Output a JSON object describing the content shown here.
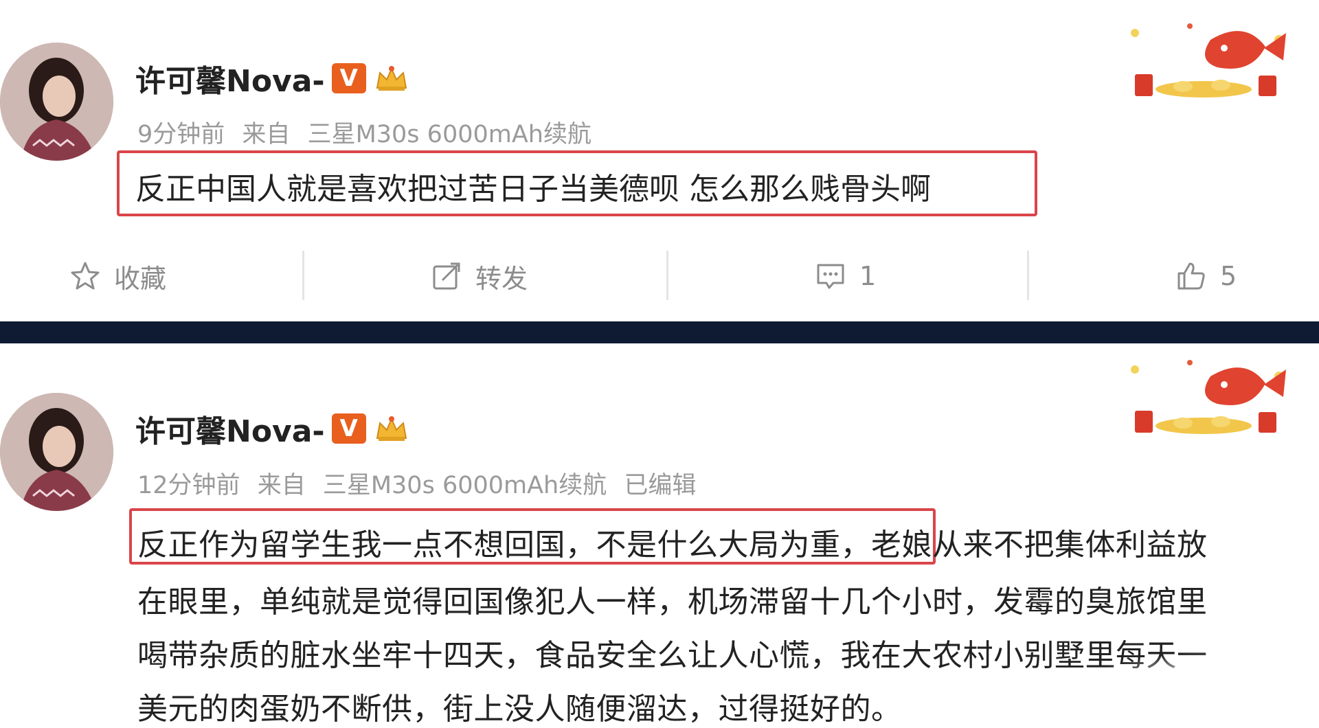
{
  "posts": [
    {
      "username": "许可馨Nova-",
      "vip_badge": "V",
      "time": "9分钟前",
      "source_prefix": "来自",
      "source": "三星M30s 6000mAh续航",
      "edited": "",
      "content": "反正中国人就是喜欢把过苦日子当美德呗 怎么那么贱骨头啊",
      "actions": {
        "favorite_label": "收藏",
        "repost_label": "转发",
        "comment_count": "1",
        "like_count": "5"
      }
    },
    {
      "username": "许可馨Nova-",
      "vip_badge": "V",
      "time": "12分钟前",
      "source_prefix": "来自",
      "source": "三星M30s 6000mAh续航",
      "edited": "已编辑",
      "content_lines": [
        "反正作为留学生我一点不想回国，不是什么大局为重，老娘从来不把集体利益放",
        "在眼里，单纯就是觉得回国像犯人一样，机场滞留十几个小时，发霉的臭旅馆里",
        "喝带杂质的脏水坐牢十四天，食品安全么让人心慌，我在大农村小别墅里每天一",
        "美元的肉蛋奶不断供，街上没人随便溜达，过得挺好的。"
      ]
    }
  ],
  "colors": {
    "highlight_border": "#d9454a",
    "vip_badge": "#e95f1e",
    "meta_text": "#9a9a9a",
    "divider": "#0e1b33"
  },
  "icons": [
    "star-icon",
    "repost-icon",
    "comment-icon",
    "like-icon",
    "crown-icon",
    "fortune-fish-decoration"
  ]
}
